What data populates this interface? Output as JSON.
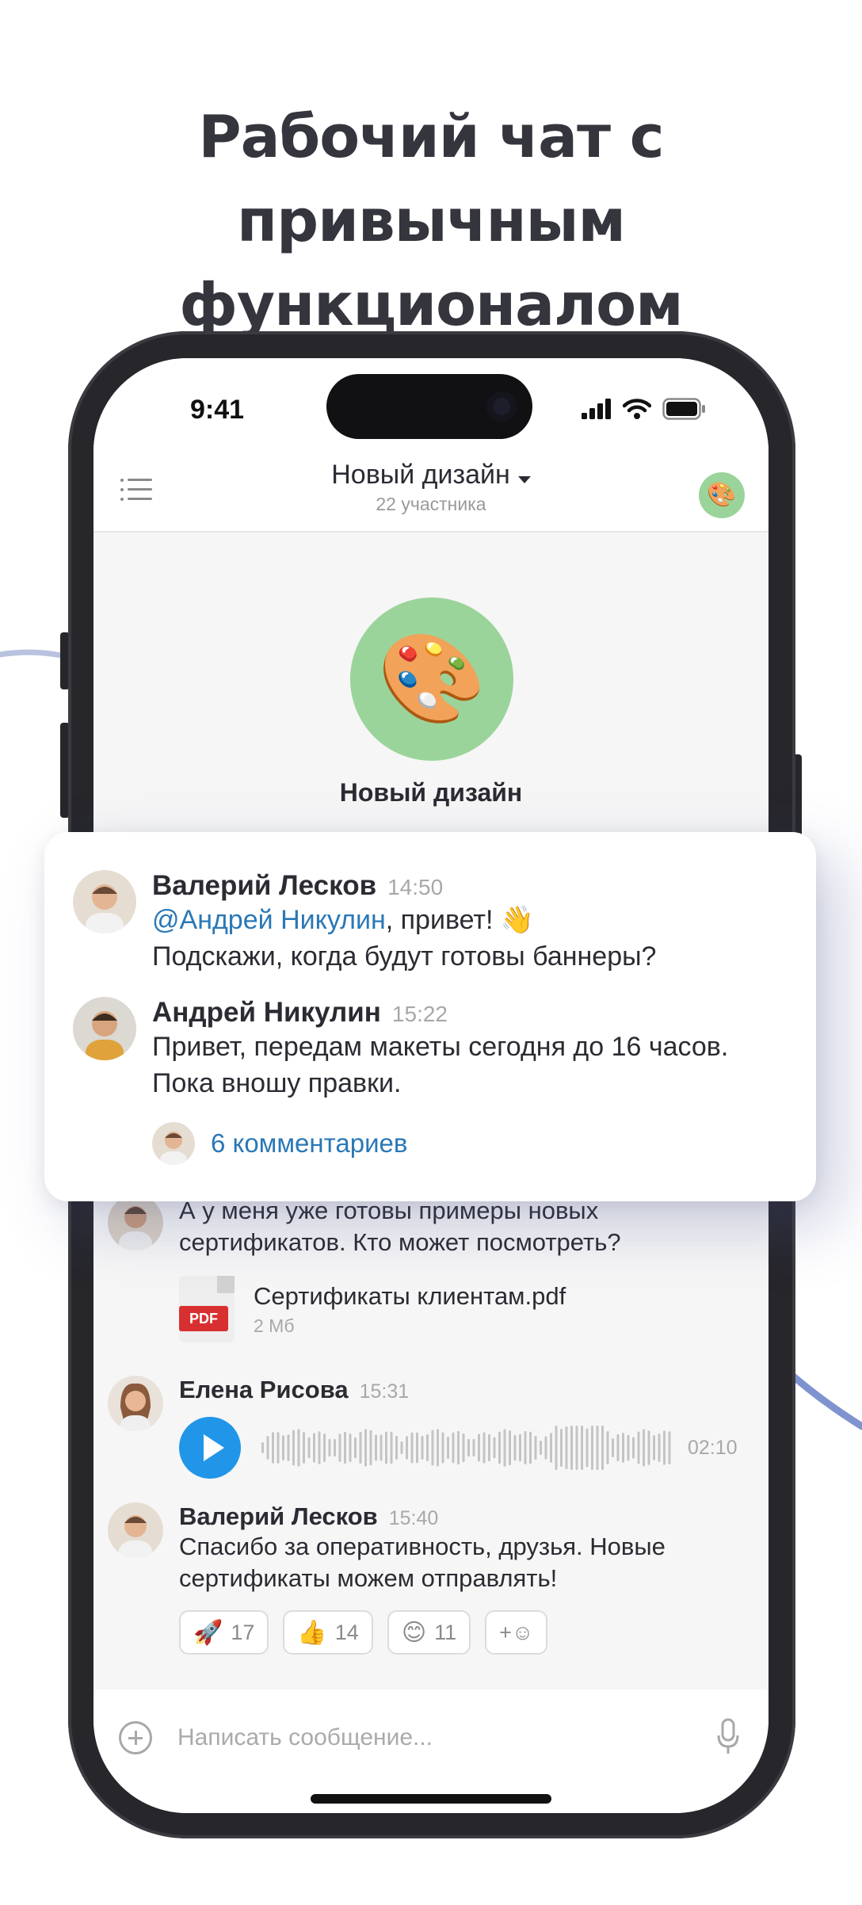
{
  "headline": {
    "line1": "Рабочий чат с привычным",
    "line2": "функционалом"
  },
  "status_bar": {
    "time": "9:41",
    "icons": [
      "signal-icon",
      "wifi-icon",
      "battery-icon"
    ]
  },
  "chat_header": {
    "title": "Новый дизайн",
    "subtitle": "22 участника",
    "avatar_emoji": "🎨"
  },
  "group": {
    "name": "Новый дизайн",
    "emoji": "🎨"
  },
  "highlight_card": {
    "messages": [
      {
        "author": "Валерий Лесков",
        "time": "14:50",
        "mention": "@Андрей Никулин",
        "line1_rest": ", привет! 👋",
        "line2": "Подскажи, когда будут готовы баннеры?"
      },
      {
        "author": "Андрей Никулин",
        "time": "15:22",
        "line1": "Привет, передам макеты сегодня до 16 часов.",
        "line2": "Пока вношу правки."
      }
    ],
    "comments_label": "6 комментариев"
  },
  "messages": [
    {
      "text": "А у меня уже готовы примеры новых сертификатов. Кто может посмотреть?",
      "attachment": {
        "type_label": "PDF",
        "name": "Сертификаты клиентам.pdf",
        "size": "2 Мб"
      }
    },
    {
      "author": "Елена Рисова",
      "time": "15:31",
      "voice_duration": "02:10"
    },
    {
      "author": "Валерий Лесков",
      "time": "15:40",
      "text": "Спасибо за оперативность, друзья. Новые сертификаты можем отправлять!",
      "reactions": [
        {
          "emoji": "🚀",
          "count": "17"
        },
        {
          "emoji": "👍",
          "count": "14"
        },
        {
          "emoji": "😊",
          "count": "11"
        }
      ],
      "add_reaction_label": "+☺"
    }
  ],
  "composer": {
    "placeholder": "Написать сообщение..."
  },
  "colors": {
    "accent_blue": "#2196e8",
    "link_blue": "#2a78b6",
    "group_green": "#9bd49a",
    "pdf_red": "#d83030"
  }
}
